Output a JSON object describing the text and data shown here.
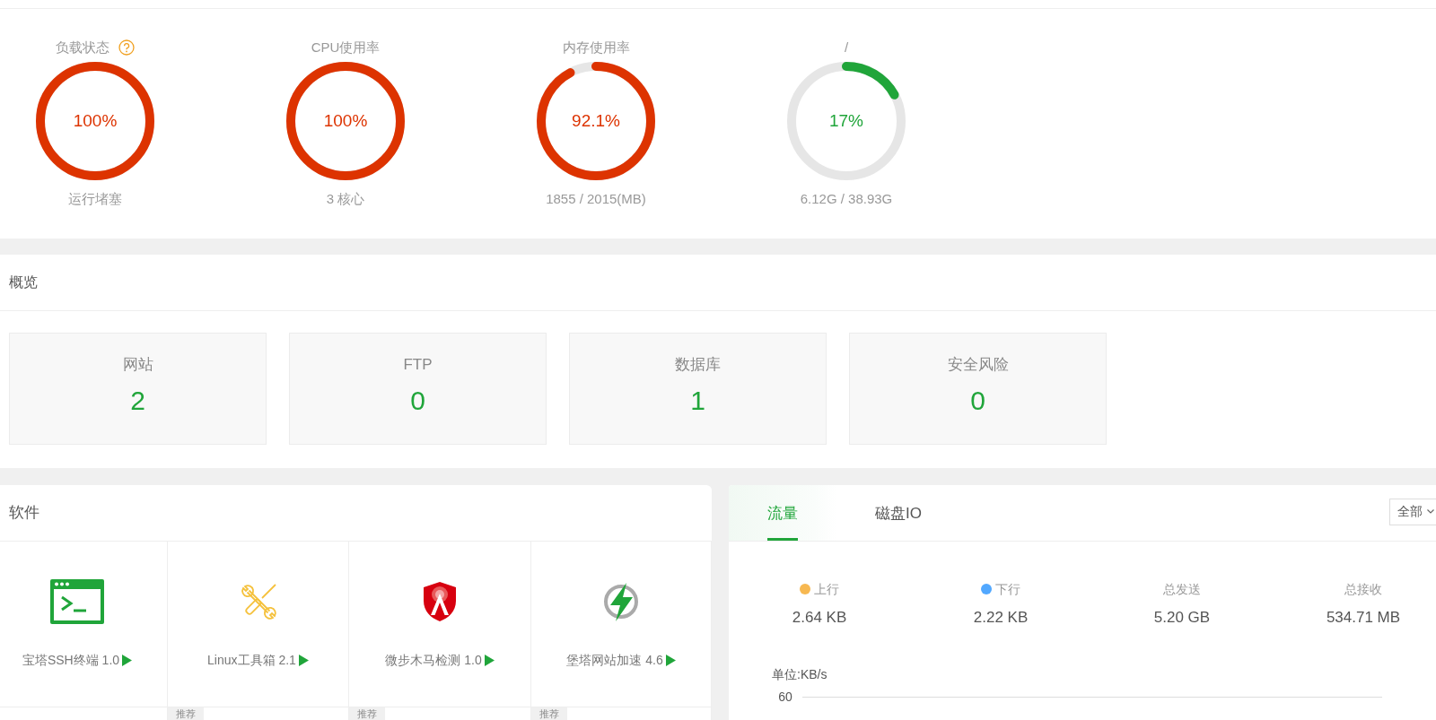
{
  "status": {
    "gauges": [
      {
        "title": "负载状态",
        "help_icon": true,
        "value": "100%",
        "level": 1,
        "color": "#dd3300",
        "caption": "运行堵塞"
      },
      {
        "title": "CPU使用率",
        "help_icon": false,
        "value": "100%",
        "level": 1,
        "color": "#dd3300",
        "caption": "3 核心"
      },
      {
        "title": "内存使用率",
        "help_icon": false,
        "value": "92.1%",
        "level": 0.921,
        "color": "#dd3300",
        "caption": "1855 / 2015(MB)"
      },
      {
        "title": "/",
        "help_icon": false,
        "value": "17%",
        "level": 0.17,
        "color": "#20a53a",
        "caption": "6.12G / 38.93G"
      }
    ]
  },
  "overview": {
    "title": "概览",
    "cards": [
      {
        "label": "网站",
        "value": "2"
      },
      {
        "label": "FTP",
        "value": "0"
      },
      {
        "label": "数据库",
        "value": "1"
      },
      {
        "label": "安全风险",
        "value": "0"
      }
    ]
  },
  "software": {
    "title": "软件",
    "items": [
      {
        "name": "宝塔SSH终端 1.0"
      },
      {
        "name": "Linux工具箱 2.1"
      },
      {
        "name": "微步木马检测 1.0"
      },
      {
        "name": "堡塔网站加速 4.6"
      }
    ],
    "next_row": [
      {
        "kind": "plain"
      },
      {
        "kind": "recommended",
        "badge": "推荐"
      },
      {
        "kind": "recommended",
        "badge": "推荐"
      },
      {
        "kind": "recommended",
        "badge": "推荐"
      }
    ]
  },
  "traffic": {
    "tabs": [
      {
        "label": "流量",
        "selected": true
      },
      {
        "label": "磁盘IO",
        "selected": false
      }
    ],
    "filter": {
      "value": "全部"
    },
    "stats": [
      {
        "label": "上行",
        "value": "2.64 KB",
        "color": "#f7b851"
      },
      {
        "label": "下行",
        "value": "2.22 KB",
        "color": "#52a8ff"
      },
      {
        "label": "总发送",
        "value": "5.20 GB"
      },
      {
        "label": "总接收",
        "value": "534.71 MB"
      }
    ],
    "chart": {
      "unit": "单位:KB/s",
      "y_ticks": [
        "60"
      ]
    }
  }
}
